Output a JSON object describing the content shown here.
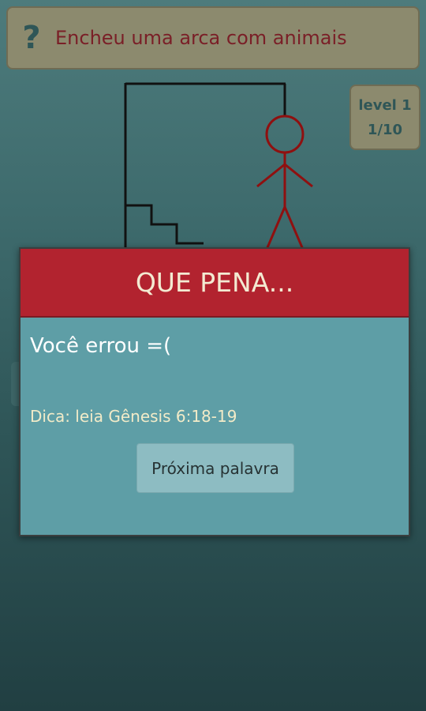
{
  "hint": {
    "icon": "question-mark-icon",
    "icon_glyph": "?",
    "text": "Encheu uma arca com animais"
  },
  "level": {
    "label": "level 1",
    "progress": "1/10"
  },
  "dialog": {
    "title": "QUE PENA...",
    "message": "Você errou =(",
    "tip": "Dica: leia Gênesis 6:18-19",
    "next_button": "Próxima palavra"
  },
  "colors": {
    "hint_text": "#7a1f27",
    "dialog_header": "#b2232f",
    "dialog_body": "#5e9ea6",
    "hangman": "#8f1010"
  }
}
